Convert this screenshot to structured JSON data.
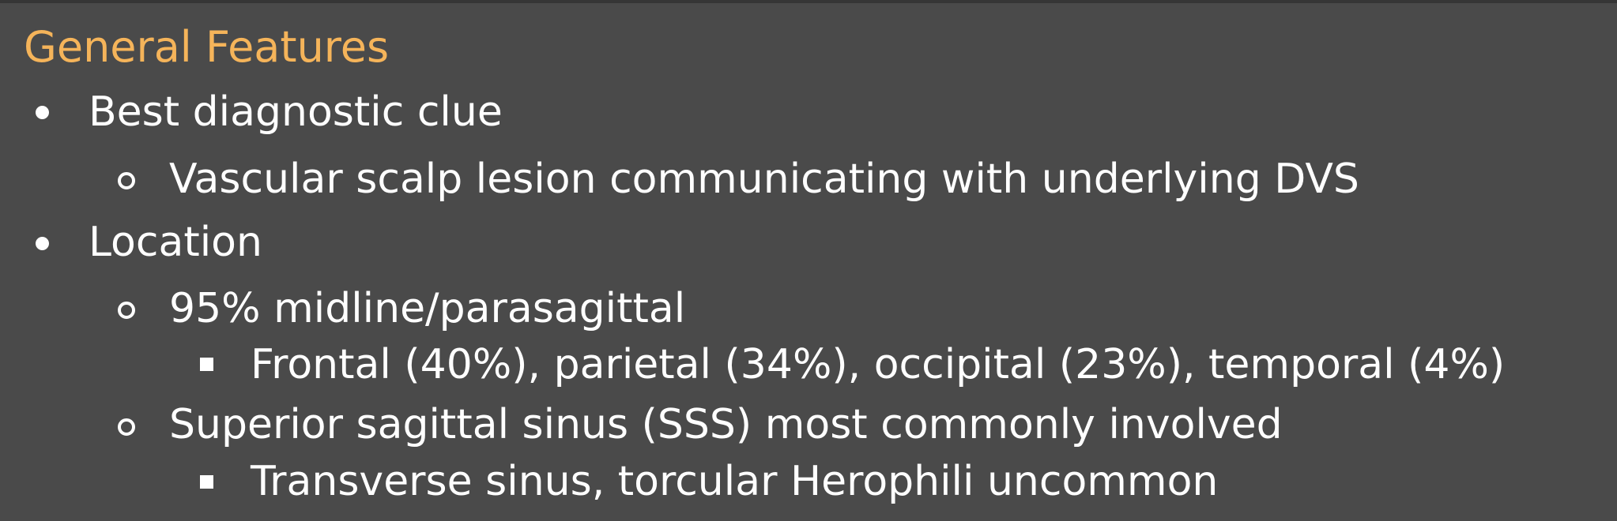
{
  "heading": "General Features",
  "outline": [
    {
      "level": 1,
      "text": "Best diagnostic clue"
    },
    {
      "level": 2,
      "text": "Vascular scalp lesion communicating with underlying DVS"
    },
    {
      "level": 1,
      "text": "Location"
    },
    {
      "level": 2,
      "text": "95% midline/parasagittal"
    },
    {
      "level": 3,
      "text": "Frontal (40%), parietal (34%), occipital (23%), temporal (4%)"
    },
    {
      "level": 2,
      "text": "Superior sagittal sinus (SSS) most commonly involved"
    },
    {
      "level": 3,
      "text": "Transverse sinus, torcular Herophili uncommon"
    }
  ],
  "colors": {
    "background": "#4a4a4a",
    "heading": "#f5b45a",
    "body_text": "#ffffff"
  }
}
